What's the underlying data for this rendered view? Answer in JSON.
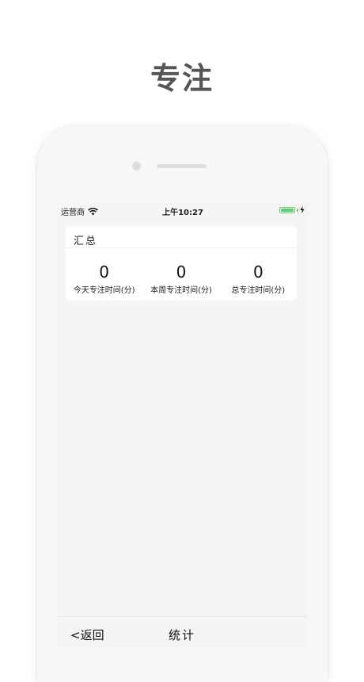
{
  "promo": {
    "title": "专注"
  },
  "status_bar": {
    "carrier": "运营商",
    "time": "上午10:27",
    "battery_color": "#4cd964"
  },
  "summary": {
    "title": "汇总",
    "stats": [
      {
        "value": "0",
        "label": "今天专注时间(分)"
      },
      {
        "value": "0",
        "label": "本周专注时间(分)"
      },
      {
        "value": "0",
        "label": "总专注时间(分)"
      }
    ]
  },
  "nav": {
    "back_label": "<返回",
    "title": "统计"
  }
}
